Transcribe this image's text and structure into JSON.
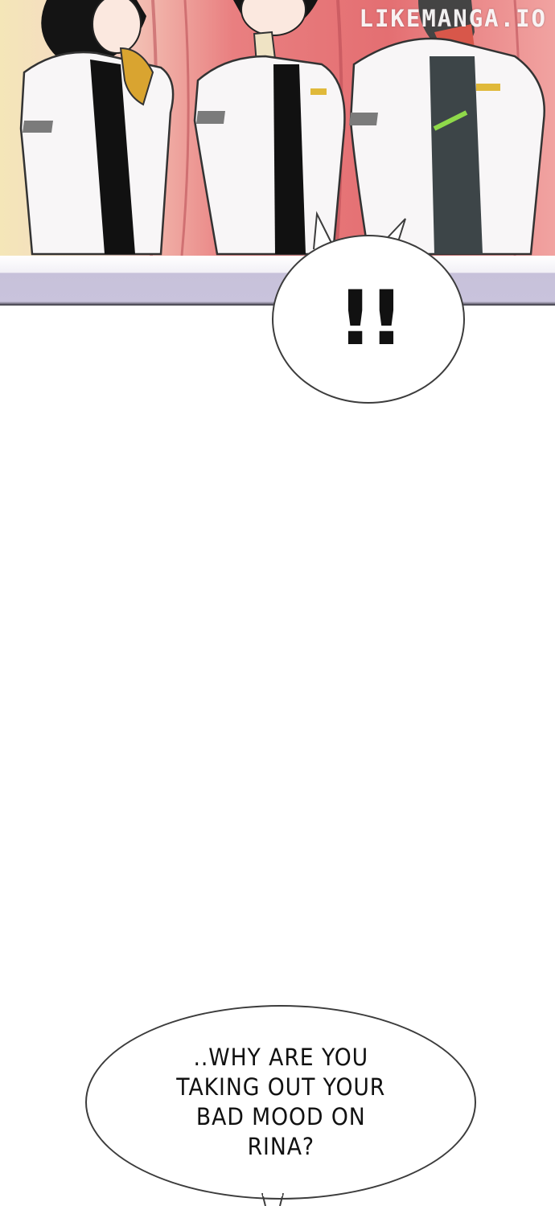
{
  "panel": {
    "watermark": "LIKEMANGA.IO",
    "colors": {
      "curtain": "#e46f72",
      "wall": "#f4e6b8",
      "shirt": "#f7f5f6",
      "trim": "#7b7b7b",
      "tie": "#111111"
    }
  },
  "bubble_top": {
    "text": "!!"
  },
  "bubble_bottom": {
    "text": "..WHY ARE YOU\nTAKING OUT YOUR\nBAD MOOD ON\nRINA?"
  }
}
